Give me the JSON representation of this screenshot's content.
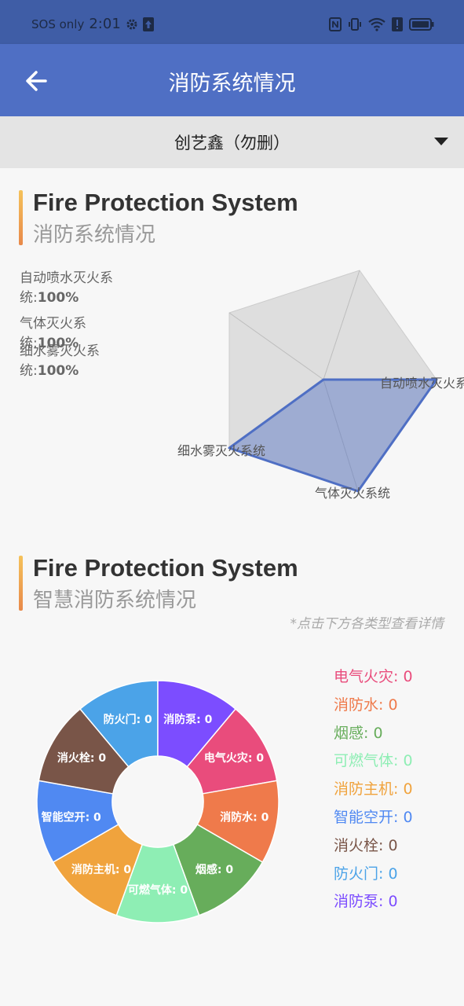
{
  "status_bar": {
    "carrier": "SOS only",
    "time": "2:01"
  },
  "app_bar": {
    "title": "消防系统情况"
  },
  "selector": {
    "value": "创艺鑫（勿删）"
  },
  "section1": {
    "en_title": "Fire Protection System",
    "cn_title": "消防系统情况",
    "stats": [
      {
        "label": "自动喷水灭火系统:",
        "value": "100%"
      },
      {
        "label": "气体灭火系统:",
        "value": "100%"
      },
      {
        "label": "细水雾灭火系统:",
        "value": "100%"
      }
    ],
    "radar_axes": [
      "自动喷水灭火系",
      "气体灭火系统",
      "细水雾灭火系统"
    ]
  },
  "section2": {
    "en_title": "Fire Protection System",
    "cn_title": "智慧消防系统情况",
    "hint": "*点击下方各类型查看详情"
  },
  "chart_data": {
    "type": "pie",
    "variant": "donut",
    "note": "all counts are zero; slices drawn equal",
    "categories": [
      "电气火灾",
      "消防水",
      "烟感",
      "可燃气体",
      "消防主机",
      "智能空开",
      "消火栓",
      "防火门",
      "消防泵"
    ],
    "values": [
      0,
      0,
      0,
      0,
      0,
      0,
      0,
      0,
      0
    ],
    "colors": [
      "#e94c7c",
      "#ef7a4b",
      "#67ad5b",
      "#8eeeb4",
      "#f0a33d",
      "#5089f2",
      "#795548",
      "#4ba3e8",
      "#7c4dff"
    ],
    "legend_position": "right"
  },
  "legend_items": [
    {
      "label": "电气火灾: 0",
      "color": "#e94c7c"
    },
    {
      "label": "消防水: 0",
      "color": "#ef7a4b"
    },
    {
      "label": "烟感: 0",
      "color": "#67ad5b"
    },
    {
      "label": "可燃气体: 0",
      "color": "#8eeeb4"
    },
    {
      "label": "消防主机: 0",
      "color": "#f0a33d"
    },
    {
      "label": "智能空开: 0",
      "color": "#5089f2"
    },
    {
      "label": "消火栓: 0",
      "color": "#795548"
    },
    {
      "label": "防火门: 0",
      "color": "#4ba3e8"
    },
    {
      "label": "消防泵: 0",
      "color": "#7c4dff"
    }
  ]
}
